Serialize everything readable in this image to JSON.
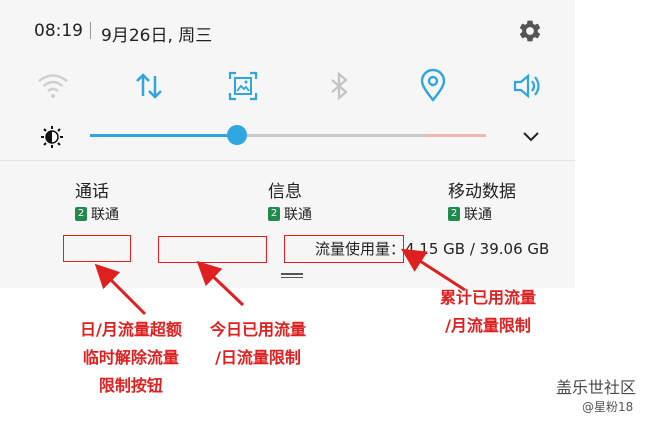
{
  "status": {
    "time": "08:19",
    "date": "9月26日, 周三"
  },
  "quick_toggles": [
    {
      "icon": "wifi-icon",
      "state": "off"
    },
    {
      "icon": "data-transfer-icon",
      "state": "on"
    },
    {
      "icon": "screenshot-icon",
      "state": "on"
    },
    {
      "icon": "bluetooth-icon",
      "state": "off"
    },
    {
      "icon": "location-icon",
      "state": "on"
    },
    {
      "icon": "sound-icon",
      "state": "on"
    }
  ],
  "brightness": {
    "level": 0.37
  },
  "usage_panel": {
    "calls": {
      "title": "通话",
      "sim_number": "2",
      "carrier": "联通"
    },
    "messages": {
      "title": "信息",
      "sim_number": "2",
      "carrier": "联通"
    },
    "mobile_data": {
      "title": "移动数据",
      "sim_number": "2",
      "carrier": "联通"
    },
    "usage_text": "流量使用量：4.15 GB / 39.06 GB"
  },
  "annotations": {
    "left": [
      "日/月流量超额",
      "临时解除流量",
      "限制按钮"
    ],
    "middle": [
      "今日已用流量",
      "/日流量限制"
    ],
    "right": [
      "累计已用流量",
      "/月流量限制"
    ]
  },
  "watermark": {
    "line1": "盖乐世社区",
    "line2": "@星粉18"
  },
  "colors": {
    "accent": "#2fa6de",
    "annotation": "#e02020",
    "sim_badge": "#1f8a4c"
  }
}
